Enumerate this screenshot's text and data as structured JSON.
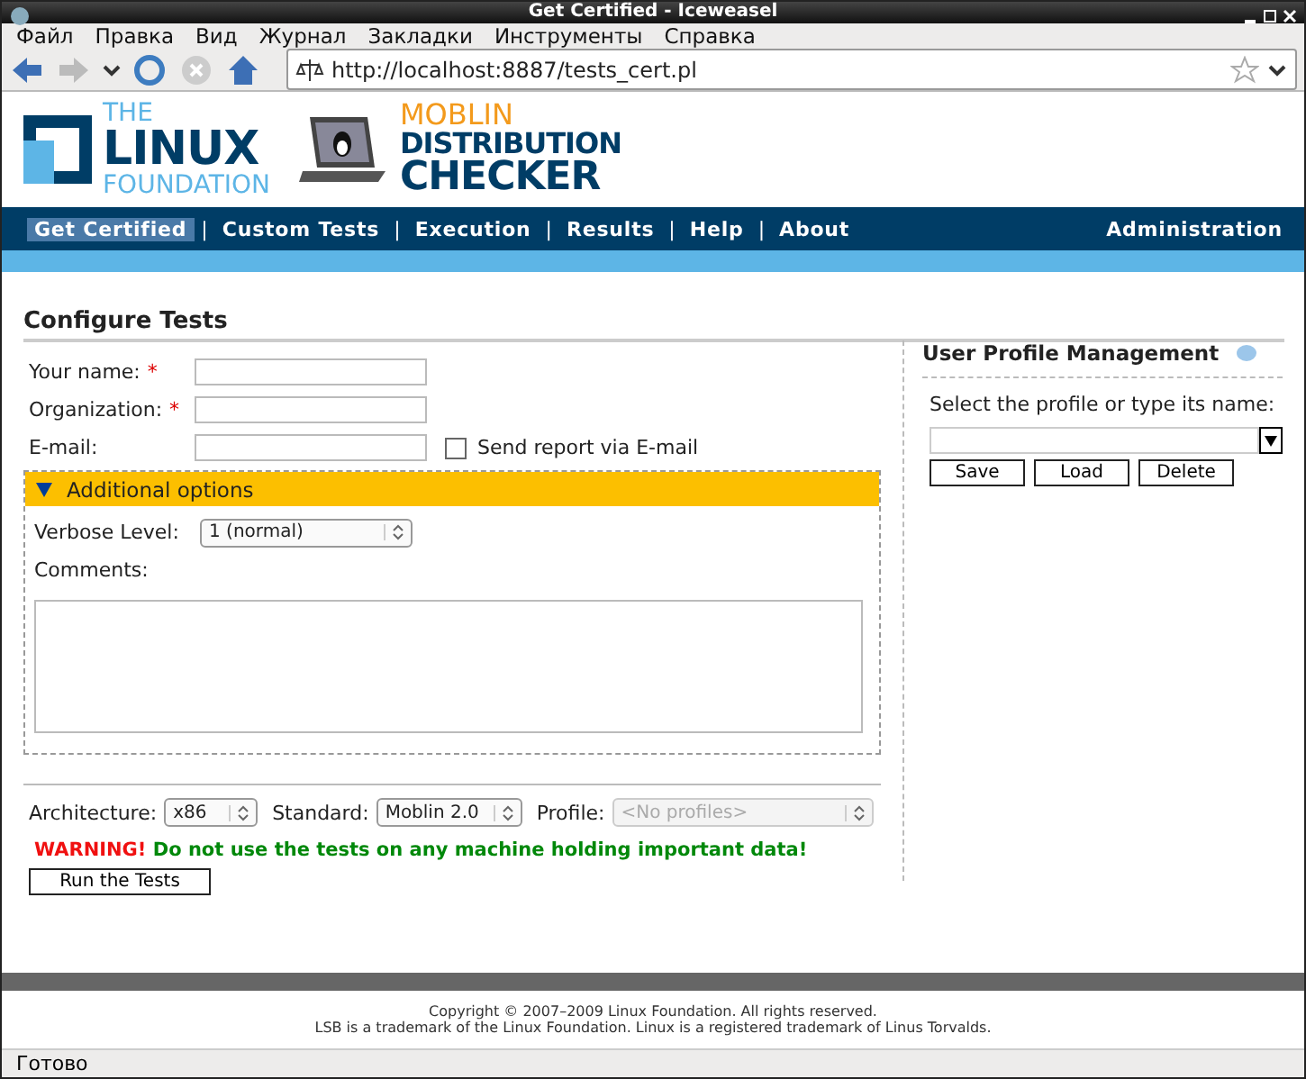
{
  "window": {
    "title": "Get Certified - Iceweasel"
  },
  "menu": [
    "Файл",
    "Правка",
    "Вид",
    "Журнал",
    "Закладки",
    "Инструменты",
    "Справка"
  ],
  "toolbar": {
    "url": "http://localhost:8887/tests_cert.pl"
  },
  "logos": {
    "foundation": [
      "THE",
      "LINUX",
      "FOUNDATION"
    ],
    "checker": [
      "MOBLIN",
      "DISTRIBUTION",
      "CHECKER"
    ]
  },
  "nav": {
    "items": [
      {
        "label": "Get Certified",
        "selected": true
      },
      {
        "label": "Custom Tests",
        "selected": false
      },
      {
        "label": "Execution",
        "selected": false
      },
      {
        "label": "Results",
        "selected": false
      },
      {
        "label": "Help",
        "selected": false
      },
      {
        "label": "About",
        "selected": false
      }
    ],
    "separator": "|",
    "admin": "Administration"
  },
  "form": {
    "title": "Configure Tests",
    "fields": [
      {
        "label": "Your name:",
        "marker": "*"
      },
      {
        "label": "Organization:",
        "marker": "*"
      },
      {
        "label": "E-mail:"
      }
    ],
    "send_report": {
      "label": "Send report via E-mail",
      "checked": false
    },
    "additional": {
      "label": "Additional options",
      "expanded": true
    },
    "verbose": {
      "label": "Verbose Level:",
      "value": "1 (normal)"
    },
    "comments": {
      "label": "Comments:"
    },
    "selects": [
      {
        "label": "Architecture:",
        "value": "x86",
        "disabled": false
      },
      {
        "label": "Standard:",
        "value": "Moblin 2.0",
        "disabled": false
      },
      {
        "label": "Profile:",
        "value": "<No profiles>",
        "disabled": true
      }
    ],
    "warning": {
      "prefix": "WARNING!",
      "text": "Do not use the tests on any machine holding important data!"
    },
    "run_button": "Run the Tests"
  },
  "profile": {
    "title": "User Profile Management",
    "prompt": "Select the profile or type its name:",
    "buttons": [
      "Save",
      "Load",
      "Delete"
    ]
  },
  "footer": [
    "Copyright © 2007–2009 Linux Foundation. All rights reserved.",
    "LSB is a trademark of the Linux Foundation. Linux is a registered trademark of Linus Torvalds."
  ],
  "status": "Готово"
}
